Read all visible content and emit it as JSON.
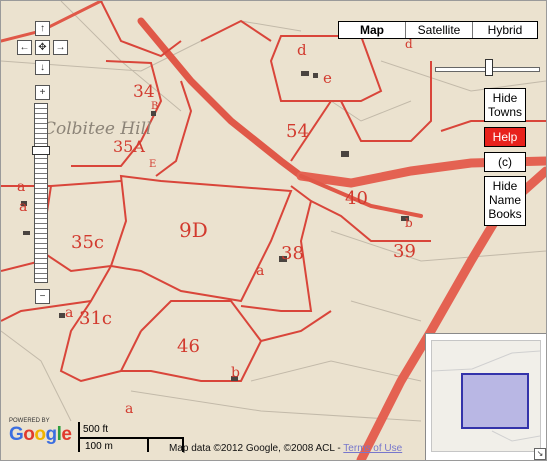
{
  "map_type": {
    "buttons": [
      {
        "label": "Map",
        "active": true
      },
      {
        "label": "Satellite",
        "active": false
      },
      {
        "label": "Hybrid",
        "active": false
      }
    ]
  },
  "navigation": {
    "pan_up_icon": "arrow-up",
    "pan_left_icon": "arrow-left",
    "pan_center_icon": "move-center",
    "pan_right_icon": "arrow-right",
    "pan_down_icon": "arrow-down",
    "zoom_in_symbol": "+",
    "zoom_out_symbol": "−"
  },
  "opacity_slider": {
    "level": 0.52
  },
  "side_buttons": {
    "hide_towns": "Hide Towns",
    "help": "Help",
    "copyright": "(c)",
    "hide_name_books": "Hide Name Books"
  },
  "overview_map": {
    "collapse_icon": "corner-arrow-icon"
  },
  "map_labels": {
    "hill_name": "Colbitee Hill",
    "parcels": [
      "34",
      "B",
      "35A",
      "E",
      "d",
      "e",
      "54",
      "40",
      "b",
      "9D",
      "38",
      "a",
      "39",
      "35c",
      "31c",
      "46",
      "a",
      "b",
      "a",
      "d",
      "a",
      "a"
    ]
  },
  "branding": {
    "powered_by": "POWERED BY",
    "logo": "Google"
  },
  "scale": {
    "imperial": "500 ft",
    "metric": "100 m"
  },
  "attribution": {
    "text": "Map data ©2012 Google, ©2008 ACL - ",
    "link": "Terms of Use"
  },
  "colors": {
    "map_background": "#ebe2cf",
    "field_boundary": "#d9453a",
    "road": "#e05848",
    "help_button": "#e8211c",
    "overview_viewport": "#3333aa"
  }
}
